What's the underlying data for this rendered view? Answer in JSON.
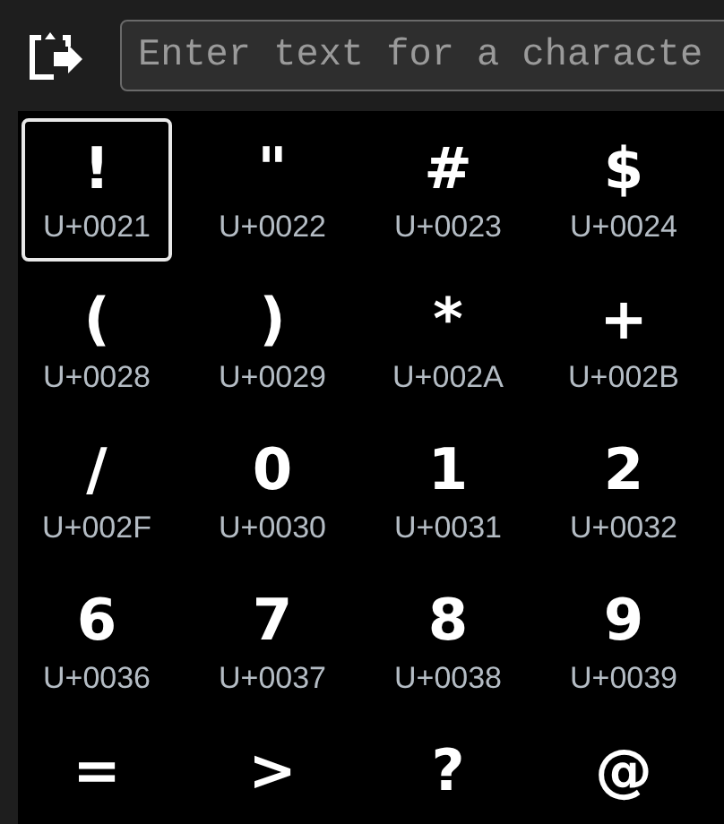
{
  "search": {
    "placeholder": "Enter text for a characte"
  },
  "characters": [
    {
      "glyph": "!",
      "code": "U+0021",
      "selected": true
    },
    {
      "glyph": "\"",
      "code": "U+0022",
      "selected": false
    },
    {
      "glyph": "#",
      "code": "U+0023",
      "selected": false
    },
    {
      "glyph": "$",
      "code": "U+0024",
      "selected": false
    },
    {
      "glyph": "(",
      "code": "U+0028",
      "selected": false
    },
    {
      "glyph": ")",
      "code": "U+0029",
      "selected": false
    },
    {
      "glyph": "*",
      "code": "U+002A",
      "selected": false
    },
    {
      "glyph": "+",
      "code": "U+002B",
      "selected": false
    },
    {
      "glyph": "/",
      "code": "U+002F",
      "selected": false
    },
    {
      "glyph": "0",
      "code": "U+0030",
      "selected": false
    },
    {
      "glyph": "1",
      "code": "U+0031",
      "selected": false
    },
    {
      "glyph": "2",
      "code": "U+0032",
      "selected": false
    },
    {
      "glyph": "6",
      "code": "U+0036",
      "selected": false
    },
    {
      "glyph": "7",
      "code": "U+0037",
      "selected": false
    },
    {
      "glyph": "8",
      "code": "U+0038",
      "selected": false
    },
    {
      "glyph": "9",
      "code": "U+0039",
      "selected": false
    },
    {
      "glyph": "=",
      "selected": false
    },
    {
      "glyph": ">",
      "selected": false
    },
    {
      "glyph": "?",
      "selected": false
    },
    {
      "glyph": "@",
      "selected": false
    }
  ]
}
